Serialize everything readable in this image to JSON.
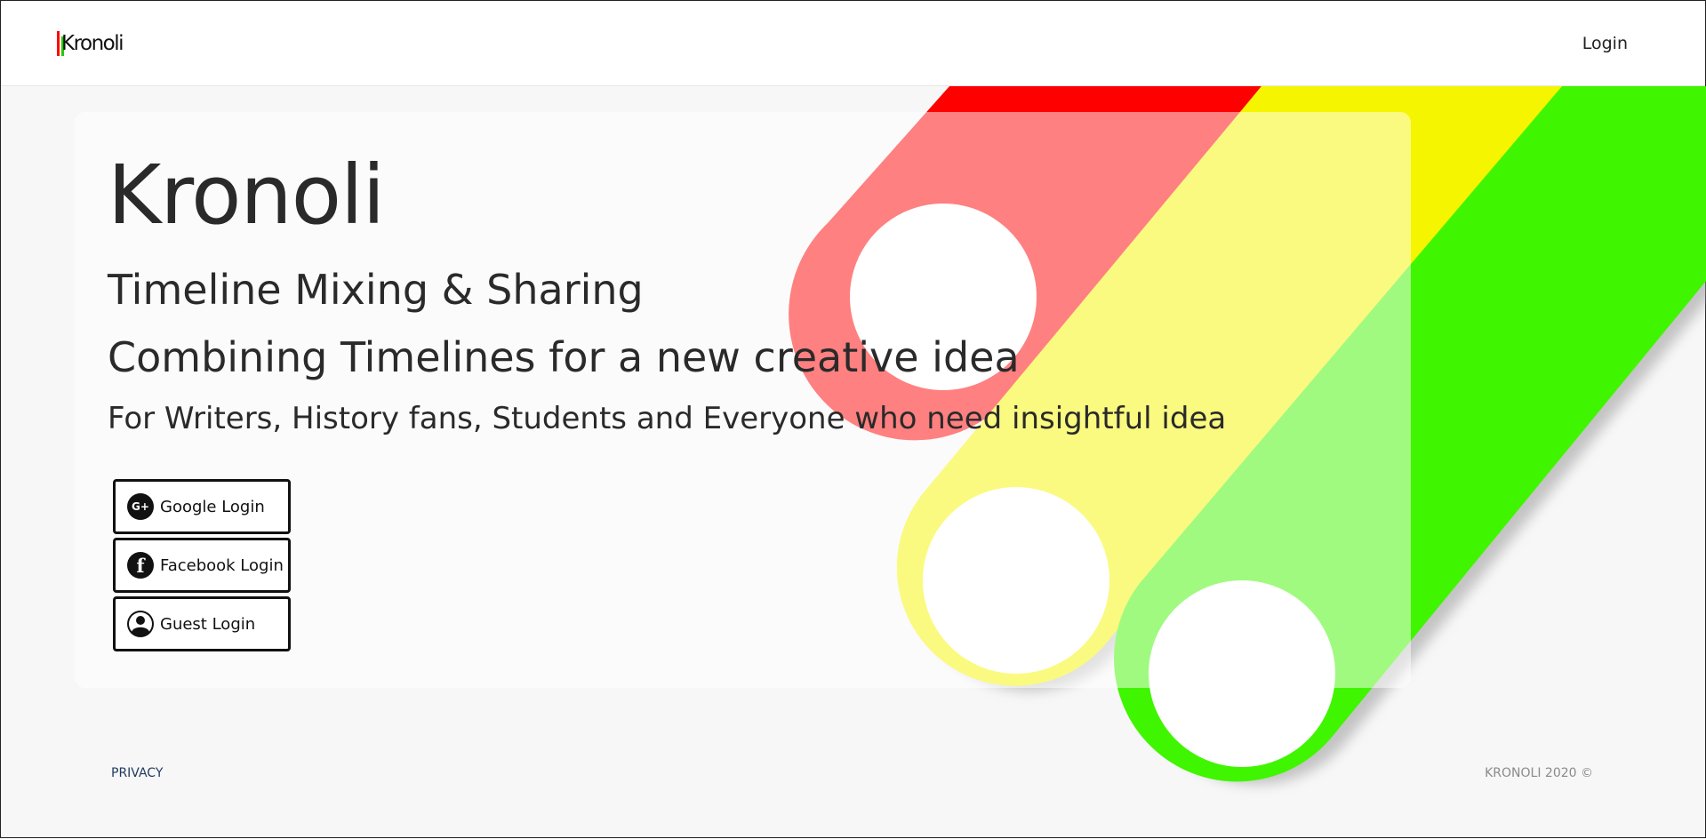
{
  "header": {
    "logo_text": "Kronoli",
    "login_label": "Login"
  },
  "hero": {
    "title": "Kronoli",
    "subtitle1": "Timeline Mixing & Sharing",
    "subtitle2": "Combining Timelines for a new creative idea",
    "subtitle3": "For Writers, History fans, Students and Everyone who need insightful idea"
  },
  "login_buttons": [
    {
      "label": "Google Login",
      "icon": "google-plus-icon",
      "glyph": "G+"
    },
    {
      "label": "Facebook Login",
      "icon": "facebook-icon",
      "glyph": "f"
    },
    {
      "label": "Guest Login",
      "icon": "user-icon",
      "glyph": ""
    }
  ],
  "footer": {
    "privacy_label": "PRIVACY",
    "copyright": "KRONOLI 2020 ©"
  },
  "colors": {
    "red": "#ff0000",
    "yellow": "#f5f500",
    "green": "#40f500",
    "text": "#2a2a2a",
    "privacy_link": "#1e3a5f"
  }
}
